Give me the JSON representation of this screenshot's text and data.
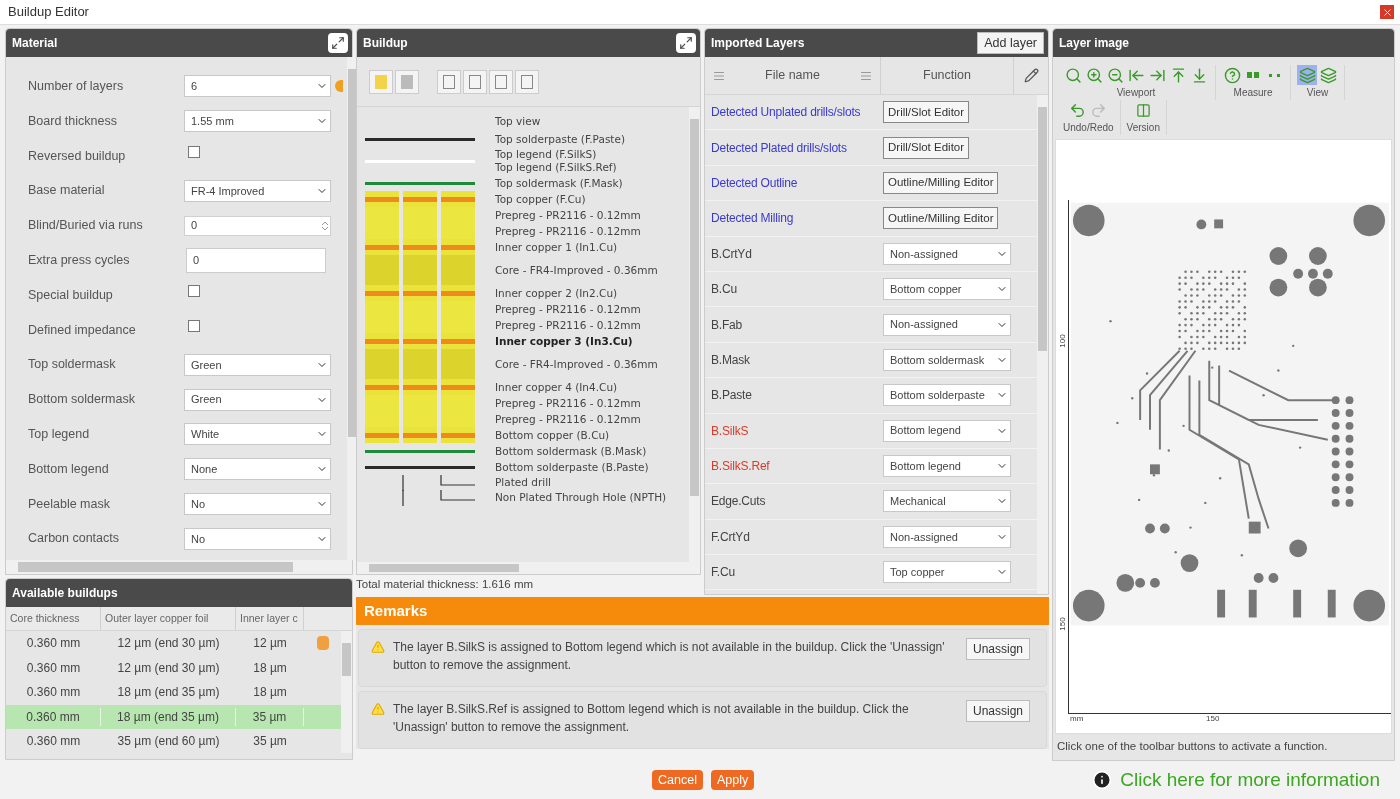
{
  "window": {
    "title": "Buildup Editor"
  },
  "material": {
    "title": "Material",
    "fields": [
      {
        "label": "Number of layers",
        "kind": "select",
        "value": "6",
        "flag": true
      },
      {
        "label": "Board thickness",
        "kind": "select",
        "value": "1.55 mm"
      },
      {
        "label": "Reversed buildup",
        "kind": "checkbox",
        "checked": false
      },
      {
        "label": "Base material",
        "kind": "select",
        "value": "FR-4 Improved"
      },
      {
        "label": "Blind/Buried via runs",
        "kind": "spin",
        "value": "0"
      },
      {
        "label": "Extra press cycles",
        "kind": "text",
        "value": "0"
      },
      {
        "label": "Special buildup",
        "kind": "checkbox",
        "checked": false
      },
      {
        "label": "Defined impedance",
        "kind": "checkbox",
        "checked": false
      },
      {
        "label": "Top soldermask",
        "kind": "select",
        "value": "Green"
      },
      {
        "label": "Bottom soldermask",
        "kind": "select",
        "value": "Green"
      },
      {
        "label": "Top legend",
        "kind": "select",
        "value": "White"
      },
      {
        "label": "Bottom legend",
        "kind": "select",
        "value": "None"
      },
      {
        "label": "Peelable mask",
        "kind": "select",
        "value": "No"
      },
      {
        "label": "Carbon contacts",
        "kind": "select",
        "value": "No"
      }
    ]
  },
  "available_buildups": {
    "title": "Available buildups",
    "columns": [
      "Core thickness",
      "Outer layer copper foil",
      "Inner layer c"
    ],
    "rows": [
      {
        "cells": [
          "0.360 mm",
          "12 µm (end 30 µm)",
          "12 µm"
        ],
        "selected": false,
        "flag": true
      },
      {
        "cells": [
          "0.360 mm",
          "12 µm (end 30 µm)",
          "18 µm"
        ],
        "selected": false,
        "flag": false
      },
      {
        "cells": [
          "0.360 mm",
          "18 µm (end 35 µm)",
          "18 µm"
        ],
        "selected": false,
        "flag": false
      },
      {
        "cells": [
          "0.360 mm",
          "18 µm (end 35 µm)",
          "35 µm"
        ],
        "selected": true,
        "flag": false
      },
      {
        "cells": [
          "0.360 mm",
          "35 µm (end 60 µm)",
          "35 µm"
        ],
        "selected": false,
        "flag": false
      }
    ]
  },
  "buildup": {
    "title": "Buildup",
    "layers": [
      {
        "kind": "view",
        "labels": [
          "Top view"
        ]
      },
      {
        "kind": "paste",
        "labels": [
          "Top solderpaste (F.Paste)"
        ]
      },
      {
        "kind": "legend",
        "labels": [
          "Top legend (F.SilkS)",
          "Top legend (F.SilkS.Ref)"
        ]
      },
      {
        "kind": "mask",
        "labels": [
          "Top soldermask (F.Mask)"
        ]
      },
      {
        "kind": "copper",
        "labels": [
          "Top copper (F.Cu)"
        ],
        "selected": false
      },
      {
        "kind": "prepreg",
        "labels": [
          "Prepreg - PR2116 - 0.12mm"
        ]
      },
      {
        "kind": "prepreg",
        "labels": [
          "Prepreg - PR2116 - 0.12mm"
        ]
      },
      {
        "kind": "copper",
        "labels": [
          "Inner copper 1 (In1.Cu)"
        ],
        "selected": false
      },
      {
        "kind": "core",
        "labels": [
          "Core - FR4-Improved - 0.36mm"
        ]
      },
      {
        "kind": "copper",
        "labels": [
          "Inner copper 2 (In2.Cu)"
        ],
        "selected": false
      },
      {
        "kind": "prepreg",
        "labels": [
          "Prepreg - PR2116 - 0.12mm"
        ]
      },
      {
        "kind": "prepreg",
        "labels": [
          "Prepreg - PR2116 - 0.12mm"
        ]
      },
      {
        "kind": "copper",
        "labels": [
          "Inner copper 3 (In3.Cu)"
        ],
        "selected": true
      },
      {
        "kind": "core",
        "labels": [
          "Core - FR4-Improved - 0.36mm"
        ]
      },
      {
        "kind": "copper",
        "labels": [
          "Inner copper 4 (In4.Cu)"
        ],
        "selected": false
      },
      {
        "kind": "prepreg",
        "labels": [
          "Prepreg - PR2116 - 0.12mm"
        ]
      },
      {
        "kind": "prepreg",
        "labels": [
          "Prepreg - PR2116 - 0.12mm"
        ]
      },
      {
        "kind": "copper",
        "labels": [
          "Bottom copper (B.Cu)"
        ],
        "selected": false
      },
      {
        "kind": "mask",
        "labels": [
          "Bottom soldermask (B.Mask)"
        ]
      },
      {
        "kind": "paste",
        "labels": [
          "Bottom solderpaste (B.Paste)"
        ]
      },
      {
        "kind": "drill",
        "labels": [
          "Plated drill"
        ]
      },
      {
        "kind": "drill",
        "labels": [
          "Non Plated Through Hole (NPTH)"
        ]
      }
    ],
    "total": "Total material thickness: 1.616 mm"
  },
  "imported_layers": {
    "title": "Imported Layers",
    "add_button": "Add layer",
    "columns": [
      "File name",
      "Function"
    ],
    "rows": [
      {
        "name": "Detected Unplated drills/slots",
        "link": true,
        "error": false,
        "kind": "button",
        "function": "Drill/Slot Editor"
      },
      {
        "name": "Detected Plated drills/slots",
        "link": true,
        "error": false,
        "kind": "button",
        "function": "Drill/Slot Editor"
      },
      {
        "name": "Detected Outline",
        "link": true,
        "error": false,
        "kind": "button",
        "function": "Outline/Milling Editor"
      },
      {
        "name": "Detected Milling",
        "link": true,
        "error": false,
        "kind": "button",
        "function": "Outline/Milling Editor"
      },
      {
        "name": "B.CrtYd",
        "link": false,
        "error": false,
        "kind": "select",
        "function": "Non-assigned"
      },
      {
        "name": "B.Cu",
        "link": false,
        "error": false,
        "kind": "select",
        "function": "Bottom copper"
      },
      {
        "name": "B.Fab",
        "link": false,
        "error": false,
        "kind": "select",
        "function": "Non-assigned"
      },
      {
        "name": "B.Mask",
        "link": false,
        "error": false,
        "kind": "select",
        "function": "Bottom soldermask"
      },
      {
        "name": "B.Paste",
        "link": false,
        "error": false,
        "kind": "select",
        "function": "Bottom solderpaste"
      },
      {
        "name": "B.SilkS",
        "link": false,
        "error": true,
        "kind": "select",
        "function": "Bottom legend"
      },
      {
        "name": "B.SilkS.Ref",
        "link": false,
        "error": true,
        "kind": "select",
        "function": "Bottom legend"
      },
      {
        "name": "Edge.Cuts",
        "link": false,
        "error": false,
        "kind": "select",
        "function": "Mechanical"
      },
      {
        "name": "F.CrtYd",
        "link": false,
        "error": false,
        "kind": "select",
        "function": "Non-assigned"
      },
      {
        "name": "F.Cu",
        "link": false,
        "error": false,
        "kind": "select",
        "function": "Top copper"
      }
    ]
  },
  "layer_image": {
    "title": "Layer image",
    "toolbar": [
      {
        "label": "Viewport",
        "tools": [
          {
            "kind": "zoom-fit",
            "selected": false
          },
          {
            "kind": "zoom-in",
            "selected": false
          },
          {
            "kind": "zoom-out",
            "selected": false
          },
          {
            "kind": "left",
            "selected": false
          },
          {
            "kind": "right",
            "selected": false
          },
          {
            "kind": "up",
            "selected": false
          },
          {
            "kind": "down",
            "selected": false
          }
        ]
      },
      {
        "label": "Measure",
        "tools": [
          {
            "kind": "help",
            "selected": false
          },
          {
            "kind": "measure-pads",
            "selected": false
          },
          {
            "kind": "measure-dots",
            "selected": false
          }
        ]
      },
      {
        "label": "View",
        "tools": [
          {
            "kind": "view-layer",
            "selected": true
          },
          {
            "kind": "view-stack",
            "selected": false
          }
        ]
      },
      {
        "label": "Undo/Redo",
        "tools": [
          {
            "kind": "undo",
            "selected": false,
            "disabled": false
          },
          {
            "kind": "redo",
            "selected": false,
            "disabled": true
          }
        ]
      },
      {
        "label": "Version",
        "tools": [
          {
            "kind": "version",
            "selected": false
          }
        ]
      }
    ],
    "y_ticks": [
      "100",
      "150"
    ],
    "x_unit": "mm",
    "x_ticks": [
      "150"
    ],
    "status": "Click one of the toolbar buttons to activate a function."
  },
  "remarks": {
    "title": "Remarks",
    "items": [
      {
        "text": "The layer B.SilkS is assigned to Bottom legend which is not available in the buildup. Click the 'Unassign' button to remove the assignment.",
        "button": "Unassign"
      },
      {
        "text": "The layer B.SilkS.Ref is assigned to Bottom legend which is not available in the buildup. Click the 'Unassign' button to remove the assignment.",
        "button": "Unassign"
      }
    ]
  },
  "footer": {
    "buttons": [
      "Cancel",
      "Apply"
    ],
    "info_link": "Click here for more information"
  }
}
